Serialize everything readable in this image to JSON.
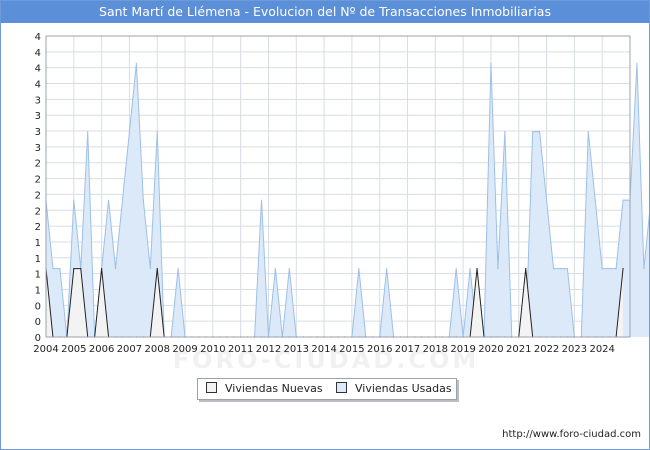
{
  "chart_data": {
    "type": "area",
    "title": "Sant Martí de Llémena - Evolucion del Nº de Transacciones Inmobiliarias",
    "xlabel": "",
    "ylabel": "",
    "x_tick_labels": [
      "2004",
      "2005",
      "2006",
      "2007",
      "2008",
      "2009",
      "2010",
      "2011",
      "2012",
      "2013",
      "2014",
      "2015",
      "2016",
      "2017",
      "2018",
      "2019",
      "2020",
      "2021",
      "2022",
      "2023",
      "2024"
    ],
    "y_tick_labels": [
      "0",
      "0",
      "0",
      "1",
      "1",
      "1",
      "1",
      "2",
      "2",
      "2",
      "2",
      "2",
      "3",
      "3",
      "3",
      "3",
      "4",
      "4",
      "4",
      "4"
    ],
    "ylim": [
      0,
      4.4
    ],
    "x_unit": "quarter",
    "grid": true,
    "legend_position": "bottom",
    "series": [
      {
        "name": "Viviendas Nuevas",
        "color": "#f3f3f3",
        "stroke": "#222222",
        "values": [
          1,
          0,
          0,
          0,
          1,
          1,
          0,
          0,
          1,
          0,
          0,
          0,
          0,
          0,
          0,
          0,
          1,
          0,
          0,
          0,
          0,
          0,
          0,
          0,
          0,
          0,
          0,
          0,
          0,
          0,
          0,
          0,
          0,
          0,
          0,
          0,
          0,
          0,
          0,
          0,
          0,
          0,
          0,
          0,
          0,
          0,
          0,
          0,
          0,
          0,
          0,
          0,
          0,
          0,
          0,
          0,
          0,
          0,
          0,
          0,
          0,
          0,
          1,
          0,
          0,
          0,
          0,
          0,
          0,
          1,
          0,
          0,
          0,
          0,
          0,
          0,
          0,
          0,
          0,
          0,
          0,
          0,
          0,
          1
        ]
      },
      {
        "name": "Viviendas Usadas",
        "color": "#dce9f8",
        "stroke": "#9cc0e8",
        "values": [
          2,
          1,
          1,
          0,
          2,
          1,
          3,
          0,
          1,
          2,
          1,
          2,
          3,
          4,
          2,
          1,
          3,
          0,
          0,
          1,
          0,
          0,
          0,
          0,
          0,
          0,
          0,
          0,
          0,
          0,
          0,
          2,
          0,
          1,
          0,
          1,
          0,
          0,
          0,
          0,
          0,
          0,
          0,
          0,
          0,
          1,
          0,
          0,
          0,
          1,
          0,
          0,
          0,
          0,
          0,
          0,
          0,
          0,
          0,
          1,
          0,
          1,
          0,
          0,
          4,
          1,
          3,
          0,
          0,
          0,
          3,
          3,
          2,
          1,
          1,
          1,
          0,
          0,
          3,
          2,
          1,
          1,
          1,
          2,
          2,
          4,
          1,
          2,
          0,
          0,
          1,
          1,
          1,
          1,
          2,
          2
        ]
      }
    ]
  },
  "legend": {
    "nuevas_label": "Viviendas Nuevas",
    "usadas_label": "Viviendas Usadas"
  },
  "watermark": "FORO-CIUDAD.COM",
  "source_url": "http://www.foro-ciudad.com"
}
